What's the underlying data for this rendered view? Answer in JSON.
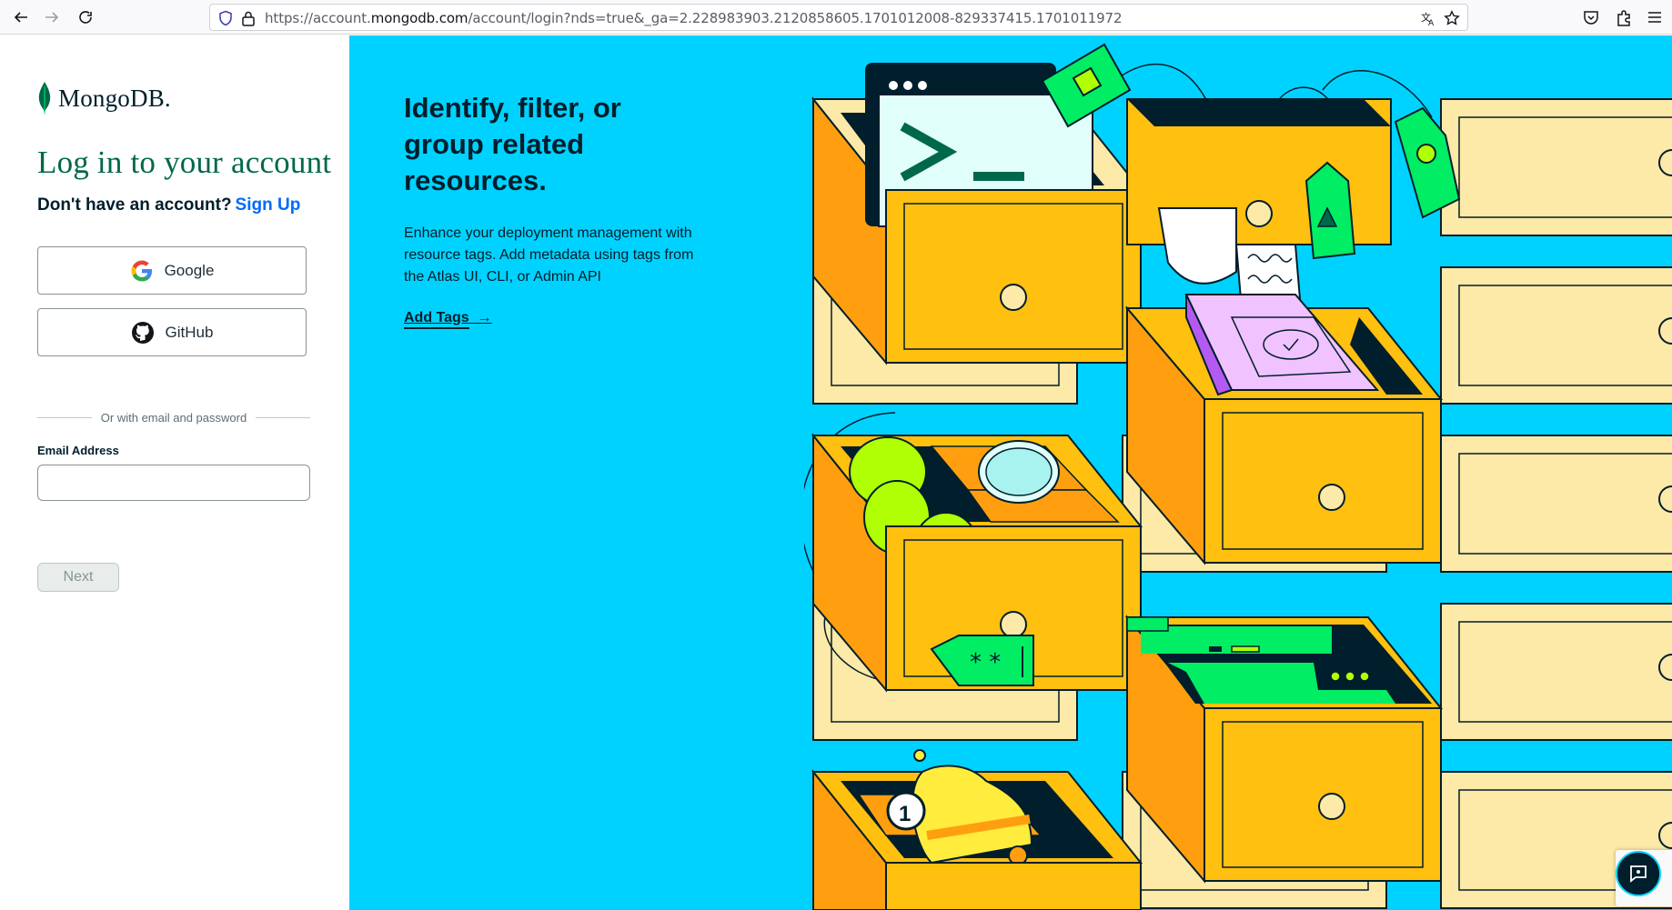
{
  "browser": {
    "url_prefix": "https://account.",
    "url_domain": "mongodb.com",
    "url_path": "/account/login?nds=true&_ga=2.228983903.2120858605.1701012008-829337415.1701011972"
  },
  "login": {
    "logo_text": "MongoDB.",
    "title": "Log in to your account",
    "no_account_text": "Don't have an account?",
    "signup_link": "Sign Up",
    "google_label": "Google",
    "github_label": "GitHub",
    "divider_text": "Or with email and password",
    "email_label": "Email Address",
    "email_value": "",
    "next_label": "Next"
  },
  "promo": {
    "title": "Identify, filter, or group related resources.",
    "body": "Enhance your deployment management with resource tags. Add metadata using tags from the Atlas UI, CLI, or Admin API",
    "link_label": "Add Tags",
    "link_arrow": "→",
    "badge_number": "1"
  },
  "colors": {
    "brand_green": "#00684a",
    "link_blue": "#016bf8",
    "promo_bg": "#00d2ff",
    "dark": "#001e2b"
  }
}
